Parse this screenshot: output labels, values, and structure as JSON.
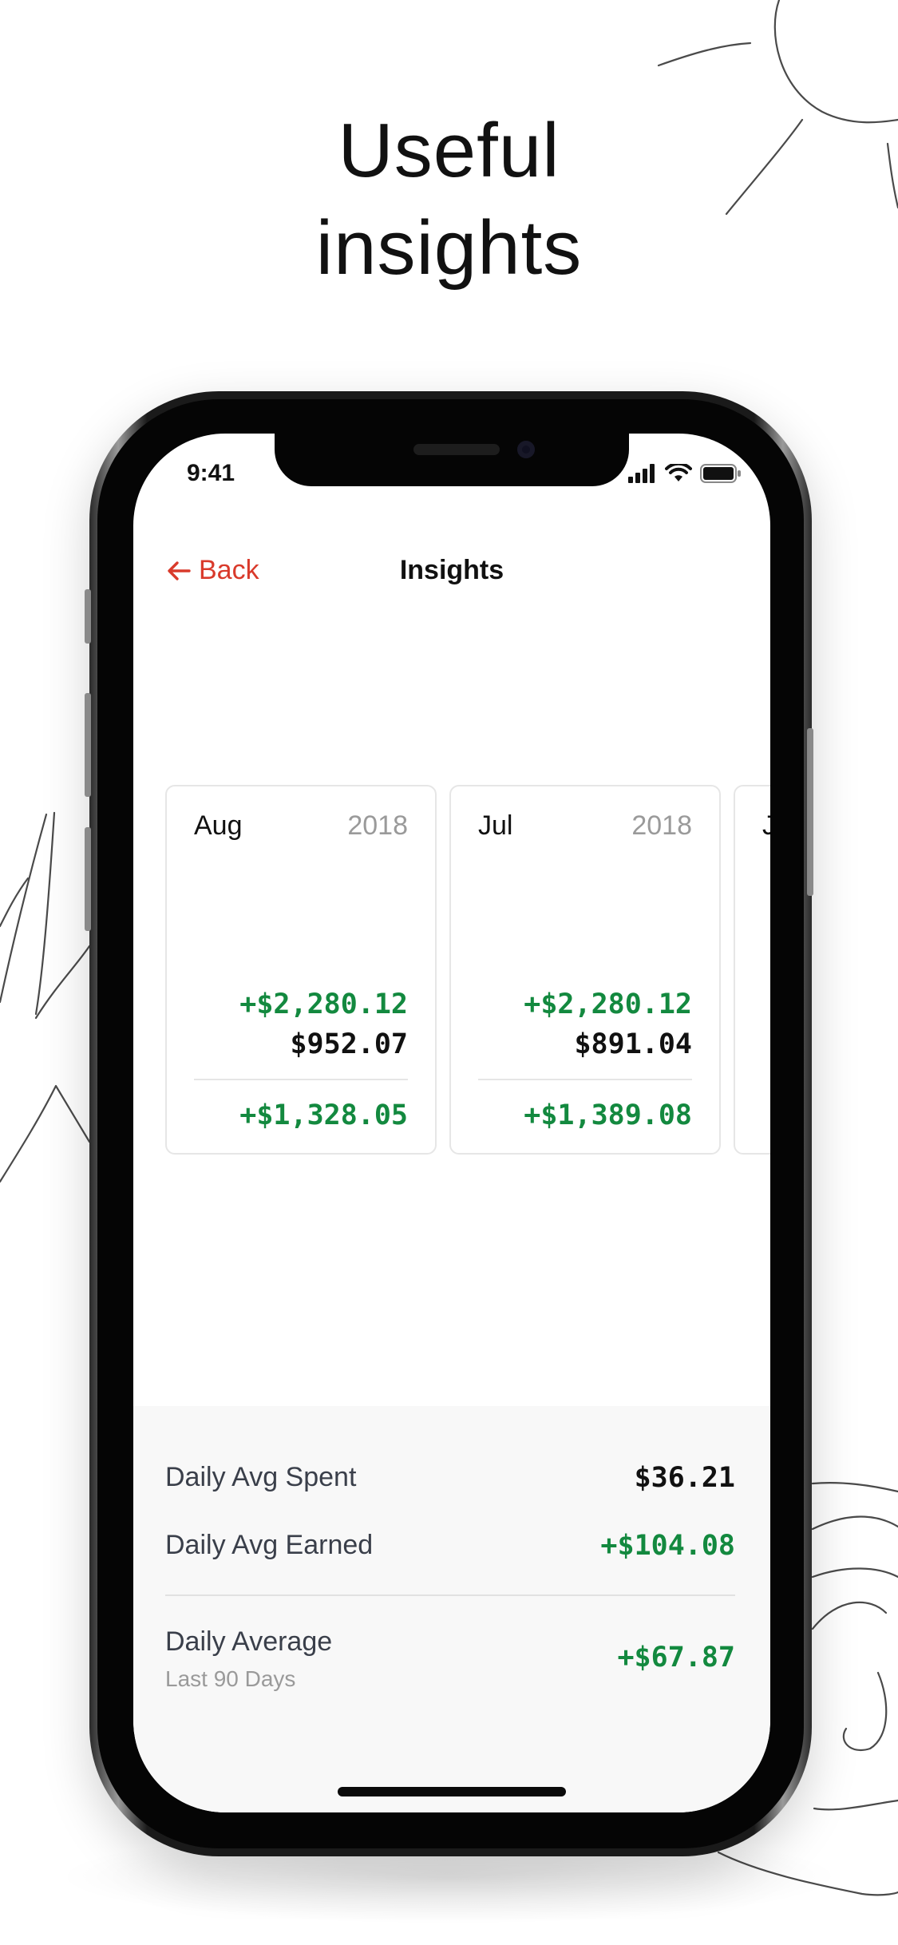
{
  "headline": {
    "line1": "Useful",
    "line2": "insights"
  },
  "status_bar": {
    "time": "9:41",
    "icons": [
      "signal-icon",
      "wifi-icon",
      "battery-icon"
    ]
  },
  "nav": {
    "back_icon": "arrow-left-icon",
    "back_label": "Back",
    "title": "Insights"
  },
  "cards": [
    {
      "month": "Aug",
      "year": "2018",
      "earned": "+$2,280.12",
      "spent": "$952.07",
      "net": "+$1,328.05"
    },
    {
      "month": "Jul",
      "year": "2018",
      "earned": "+$2,280.12",
      "spent": "$891.04",
      "net": "+$1,389.08"
    },
    {
      "month": "J"
    }
  ],
  "summary": {
    "spent_label": "Daily Avg Spent",
    "spent_value": "$36.21",
    "earned_label": "Daily Avg Earned",
    "earned_value": "+$104.08",
    "avg_label": "Daily Average",
    "avg_sub": "Last 90 Days",
    "avg_value": "+$67.87"
  },
  "colors": {
    "accent_red": "#d93a2b",
    "positive_green": "#13893f",
    "muted_gray": "#9a9a9a",
    "text_dark": "#111111"
  }
}
